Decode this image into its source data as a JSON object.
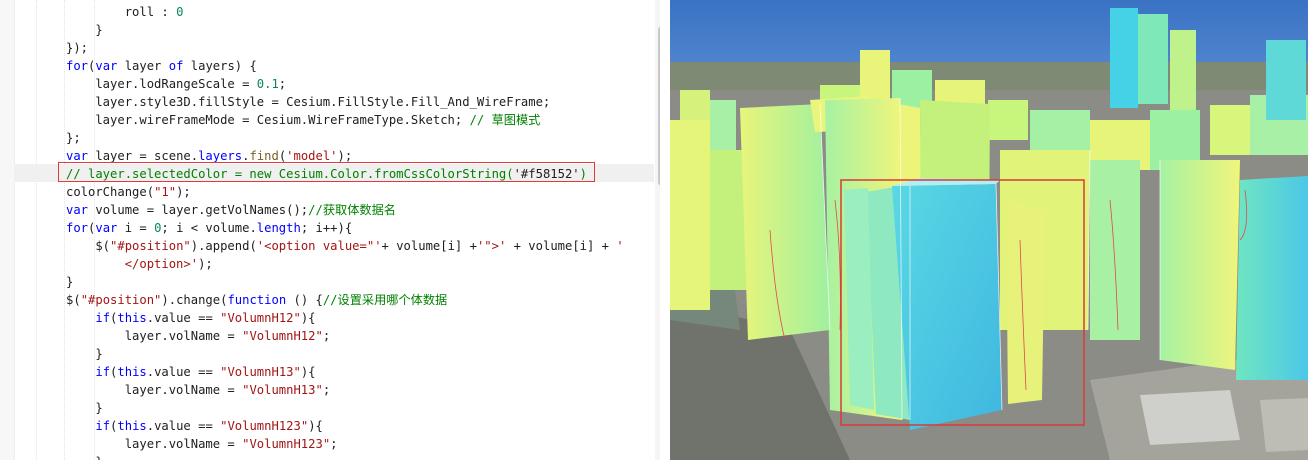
{
  "editor": {
    "lines": [
      [
        [
          "pl",
          "        roll : "
        ],
        [
          "num",
          "0"
        ]
      ],
      [
        [
          "pl",
          "    }"
        ]
      ],
      [
        [
          "pl",
          "});"
        ]
      ],
      [
        [
          "kw",
          "for"
        ],
        [
          "pl",
          "("
        ],
        [
          "kw",
          "var"
        ],
        [
          "pl",
          " layer "
        ],
        [
          "kw",
          "of"
        ],
        [
          "pl",
          " layers) {"
        ]
      ],
      [
        [
          "pl",
          "    layer.lodRangeScale = "
        ],
        [
          "num",
          "0.1"
        ],
        [
          "pl",
          ";"
        ]
      ],
      [
        [
          "pl",
          "    layer.style3D.fillStyle = Cesium.FillStyle.Fill_And_WireFrame;"
        ]
      ],
      [
        [
          "pl",
          "    layer.wireFrameMode = Cesium.WireFrameType.Sketch; "
        ],
        [
          "cmt",
          "// 草图模式"
        ]
      ],
      [
        [
          "pl",
          "};"
        ]
      ],
      [
        [
          "kw",
          "var"
        ],
        [
          "pl",
          " layer = scene."
        ],
        [
          "kw",
          "layers"
        ],
        [
          "pl",
          "."
        ],
        [
          "fn",
          "find"
        ],
        [
          "pl",
          "("
        ],
        [
          "str",
          "'model'"
        ],
        [
          "pl",
          ");"
        ]
      ],
      [
        [
          "cmt",
          "// layer.selectedColor = new Cesium.Color.fromCssColorString("
        ],
        [
          "pl",
          "'#f58152'"
        ],
        [
          "cmt",
          ")"
        ]
      ],
      [
        [
          "pl",
          "colorChange("
        ],
        [
          "str",
          "\"1\""
        ],
        [
          "pl",
          ");"
        ]
      ],
      [
        [
          "kw",
          "var"
        ],
        [
          "pl",
          " volume = layer.getVolNames();"
        ],
        [
          "cmt",
          "//获取体数据名"
        ]
      ],
      [
        [
          "kw",
          "for"
        ],
        [
          "pl",
          "("
        ],
        [
          "kw",
          "var"
        ],
        [
          "pl",
          " i = "
        ],
        [
          "num",
          "0"
        ],
        [
          "pl",
          "; i < volume."
        ],
        [
          "kw",
          "length"
        ],
        [
          "pl",
          "; i++){"
        ]
      ],
      [
        [
          "pl",
          "    $("
        ],
        [
          "str",
          "\"#position\""
        ],
        [
          "pl",
          ").append("
        ],
        [
          "str",
          "'<option value=\"'"
        ],
        [
          "pl",
          "+ volume[i] +"
        ],
        [
          "str",
          "'\">'"
        ],
        [
          "pl",
          " + volume[i] + "
        ],
        [
          "str",
          "'"
        ]
      ],
      [
        [
          "str",
          "        </option>'"
        ],
        [
          "pl",
          ");"
        ]
      ],
      [
        [
          "pl",
          "}"
        ]
      ],
      [
        [
          "pl",
          "$("
        ],
        [
          "str",
          "\"#position\""
        ],
        [
          "pl",
          ").change("
        ],
        [
          "kw",
          "function"
        ],
        [
          "pl",
          " () {"
        ],
        [
          "cmt",
          "//设置采用哪个体数据"
        ]
      ],
      [
        [
          "pl",
          "    "
        ],
        [
          "kw",
          "if"
        ],
        [
          "pl",
          "("
        ],
        [
          "kw",
          "this"
        ],
        [
          "pl",
          ".value == "
        ],
        [
          "str",
          "\"VolumnH12\""
        ],
        [
          "pl",
          "){"
        ]
      ],
      [
        [
          "pl",
          "        layer.volName = "
        ],
        [
          "str",
          "\"VolumnH12\""
        ],
        [
          "pl",
          ";"
        ]
      ],
      [
        [
          "pl",
          "    }"
        ]
      ],
      [
        [
          "pl",
          "    "
        ],
        [
          "kw",
          "if"
        ],
        [
          "pl",
          "("
        ],
        [
          "kw",
          "this"
        ],
        [
          "pl",
          ".value == "
        ],
        [
          "str",
          "\"VolumnH13\""
        ],
        [
          "pl",
          "){"
        ]
      ],
      [
        [
          "pl",
          "        layer.volName = "
        ],
        [
          "str",
          "\"VolumnH13\""
        ],
        [
          "pl",
          ";"
        ]
      ],
      [
        [
          "pl",
          "    }"
        ]
      ],
      [
        [
          "pl",
          "    "
        ],
        [
          "kw",
          "if"
        ],
        [
          "pl",
          "("
        ],
        [
          "kw",
          "this"
        ],
        [
          "pl",
          ".value == "
        ],
        [
          "str",
          "\"VolumnH123\""
        ],
        [
          "pl",
          "){"
        ]
      ],
      [
        [
          "pl",
          "        layer.volName = "
        ],
        [
          "str",
          "\"VolumnH123\""
        ],
        [
          "pl",
          ";"
        ]
      ],
      [
        [
          "pl",
          "    }"
        ]
      ]
    ],
    "highlighted_line": 9,
    "colors": {
      "keyword": "#0000ff",
      "number": "#098658",
      "string": "#a31515",
      "comment": "#008000",
      "highlight_box": "#e03a3a"
    }
  },
  "scene": {
    "description_icon": "3d-city-viewport",
    "colors": {
      "sky_top": "#3c78c8",
      "sky_bottom": "#cfe2f4",
      "ground": "#8a8a82",
      "building_green": "#7fe6a0",
      "building_yellow": "#f2f27a",
      "building_cyan": "#49cfe6",
      "selection_box": "#d63b3b"
    }
  }
}
